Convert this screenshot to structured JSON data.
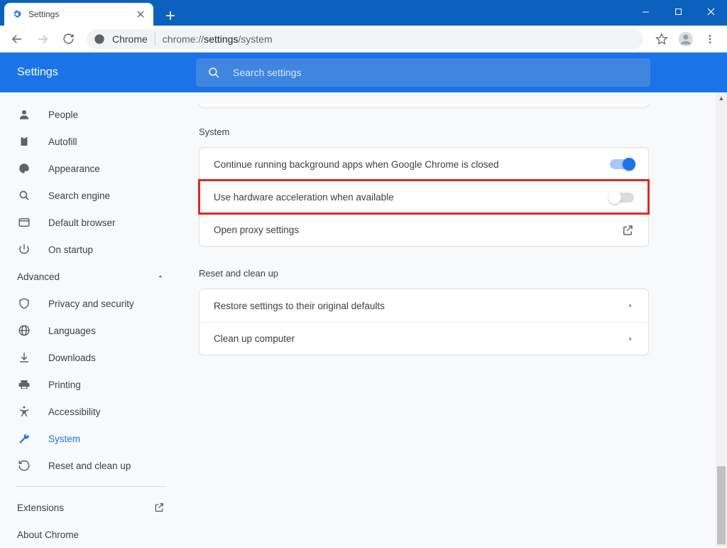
{
  "window": {
    "tab_title": "Settings",
    "omnibox_label": "Chrome",
    "url_prefix": "chrome://",
    "url_mid": "settings",
    "url_suffix": "/system"
  },
  "header": {
    "title": "Settings",
    "search_placeholder": "Search settings"
  },
  "sidebar": {
    "basic": [
      {
        "icon": "person",
        "label": "People"
      },
      {
        "icon": "clipboard",
        "label": "Autofill"
      },
      {
        "icon": "palette",
        "label": "Appearance"
      },
      {
        "icon": "search",
        "label": "Search engine"
      },
      {
        "icon": "browser",
        "label": "Default browser"
      },
      {
        "icon": "power",
        "label": "On startup"
      }
    ],
    "advanced_label": "Advanced",
    "advanced": [
      {
        "icon": "shield",
        "label": "Privacy and security"
      },
      {
        "icon": "globe",
        "label": "Languages"
      },
      {
        "icon": "download",
        "label": "Downloads"
      },
      {
        "icon": "print",
        "label": "Printing"
      },
      {
        "icon": "accessibility",
        "label": "Accessibility"
      },
      {
        "icon": "wrench",
        "label": "System",
        "active": true
      },
      {
        "icon": "restore",
        "label": "Reset and clean up"
      }
    ],
    "extensions": "Extensions",
    "about": "About Chrome"
  },
  "content": {
    "system_title": "System",
    "rows": [
      {
        "label": "Continue running background apps when Google Chrome is closed",
        "control": "toggle",
        "state": "on"
      },
      {
        "label": "Use hardware acceleration when available",
        "control": "toggle",
        "state": "off",
        "highlight": true
      },
      {
        "label": "Open proxy settings",
        "control": "launch"
      }
    ],
    "reset_title": "Reset and clean up",
    "reset_rows": [
      {
        "label": "Restore settings to their original defaults",
        "control": "chevron"
      },
      {
        "label": "Clean up computer",
        "control": "chevron"
      }
    ]
  }
}
